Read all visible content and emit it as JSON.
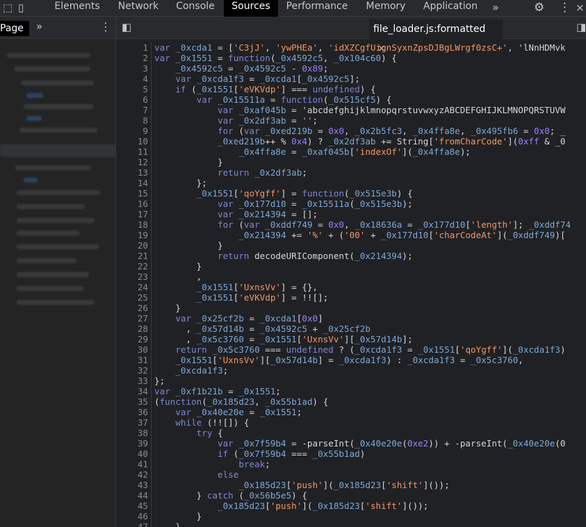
{
  "devtools": {
    "tabs": [
      "Elements",
      "Network",
      "Console",
      "Sources",
      "Performance",
      "Memory",
      "Application"
    ],
    "active_tab": "Sources"
  },
  "sidebar": {
    "page_label": "Page"
  },
  "editor": {
    "active_file": "file_loader.js:formatted",
    "lines": [
      "var _0xcda1 = ['C3jJ', 'ywPHEa', 'idXZCgfUignSyxnZpsDJBgLWrgf0zsC+', 'lNnHDMvk",
      "var _0x1551 = function(_0x4592c5, _0x104c60) {",
      "    _0x4592c5 = _0x4592c5 - 0x89;",
      "    var _0xcda1f3 = _0xcda1[_0x4592c5];",
      "    if (_0x1551['eVKVdp'] === undefined) {",
      "        var _0x15511a = function(_0x515cf5) {",
      "            var _0xaf045b = 'abcdefghijklmnopqrstuvwxyzABCDEFGHIJKLMNOPQRSTUVW",
      "            var _0x2df3ab = '';",
      "            for (var _0xed219b = 0x0, _0x2b5fc3, _0x4ffa8e, _0x495fb6 = 0x0; _",
      "            _0xed219b++ % 0x4) ? _0x2df3ab += String['fromCharCode'](0xff & _0",
      "                _0x4ffa8e = _0xaf045b['indexOf'](_0x4ffa8e);",
      "            }",
      "            return _0x2df3ab;",
      "        };",
      "        _0x1551['qoYgff'] = function(_0x515e3b) {",
      "            var _0x177d10 = _0x15511a(_0x515e3b);",
      "            var _0x214394 = [];",
      "            for (var _0xddf749 = 0x0, _0x18636a = _0x177d10['length']; _0xddf74",
      "                _0x214394 += '%' + ('00' + _0x177d10['charCodeAt'](_0xddf749)[",
      "            }",
      "            return decodeURIComponent(_0x214394);",
      "        }",
      "        ,",
      "        _0x1551['UxnsVv'] = {},",
      "        _0x1551['eVKVdp'] = !![];",
      "    }",
      "    var _0x25cf2b = _0xcda1[0x0]",
      "      , _0x57d14b = _0x4592c5 + _0x25cf2b",
      "      , _0x5c3760 = _0x1551['UxnsVv'][_0x57d14b];",
      "    return _0x5c3760 === undefined ? (_0xcda1f3 = _0x1551['qoYgff'](_0xcda1f3)",
      "    _0x1551['UxnsVv'][_0x57d14b] = _0xcda1f3) : _0xcda1f3 = _0x5c3760,",
      "    _0xcda1f3;",
      "};",
      "var _0xf1b21b = _0x1551;",
      "(function(_0x185d23, _0x55b1ad) {",
      "    var _0x40e20e = _0x1551;",
      "    while (!![]) {",
      "        try {",
      "            var _0x7f59b4 = -parseInt(_0x40e20e(0xe2)) + -parseInt(_0x40e20e(0",
      "            if (_0x7f59b4 === _0x55b1ad)",
      "                break;",
      "            else",
      "                _0x185d23['push'](_0x185d23['shift']());",
      "        } catch (_0x56b5e5) {",
      "            _0x185d23['push'](_0x185d23['shift']());",
      "        }",
      "    }"
    ]
  }
}
